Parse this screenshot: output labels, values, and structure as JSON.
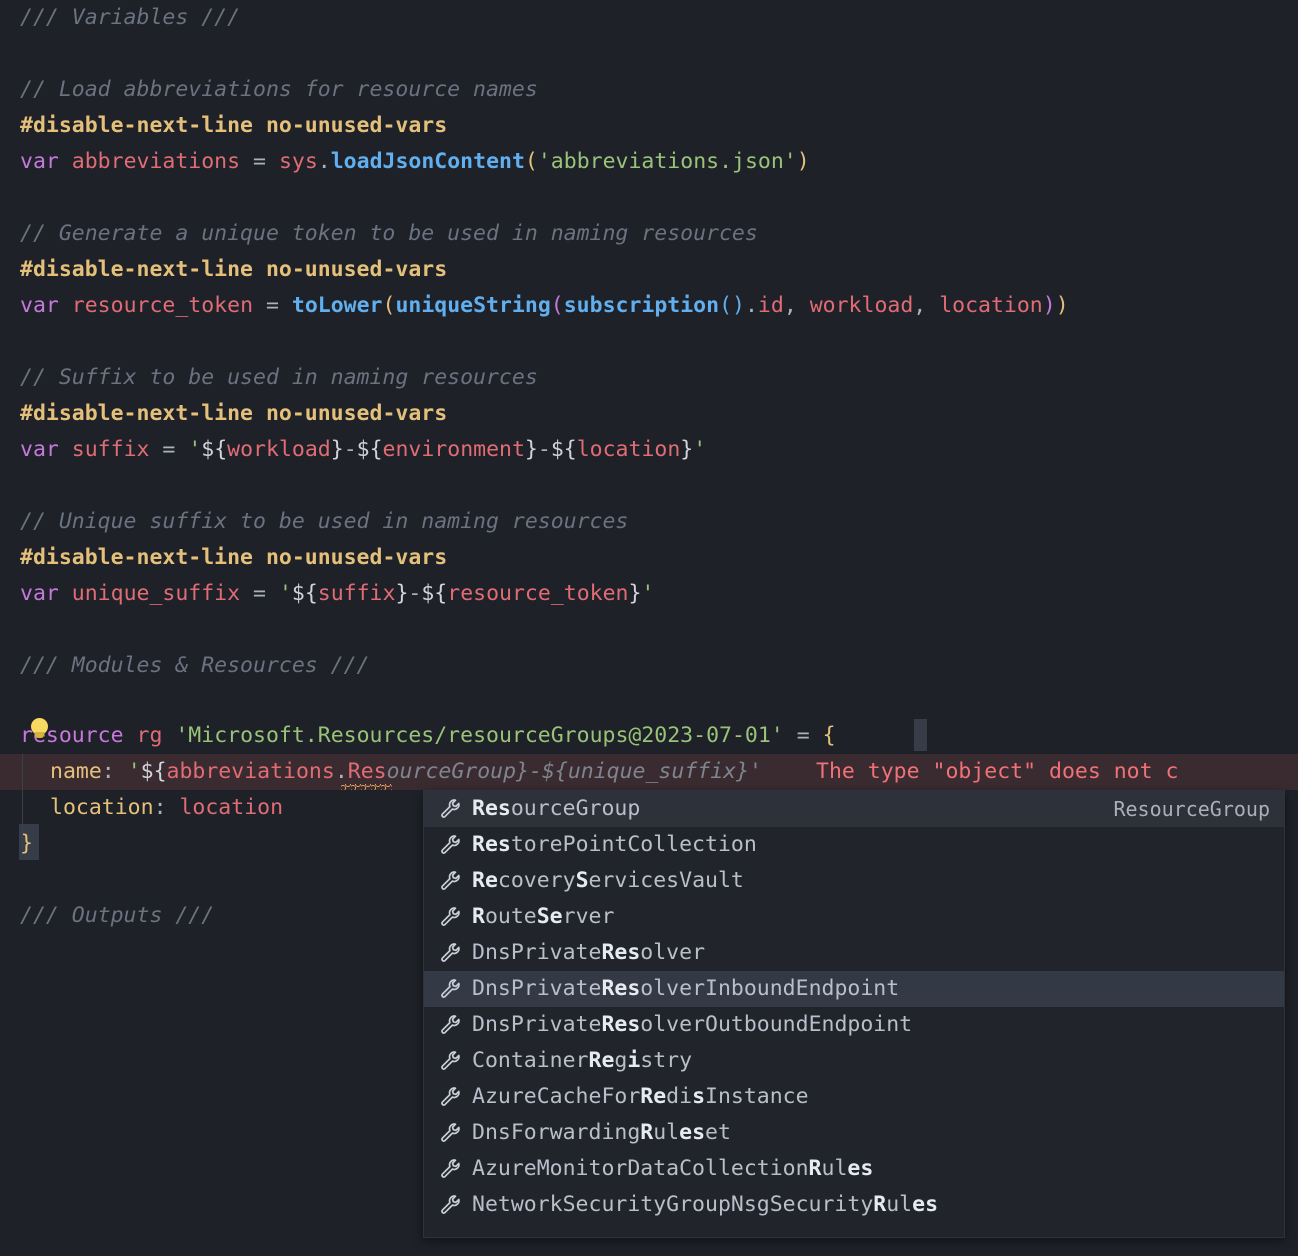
{
  "editor": {
    "language": "bicep",
    "background": "#1e2127",
    "font_size_px": 21.5,
    "line_height_px": 36,
    "colors": {
      "comment": "#6b7280",
      "decorator": "#e5c07b",
      "keyword": "#c678dd",
      "identifier": "#e06c75",
      "function": "#61afef",
      "string": "#98c379",
      "property": "#e5c07b",
      "ghost_text": "#7f848e",
      "error_text": "#f07178",
      "error_line_bg": "#3a2b30",
      "squiggle": "#e5a05b"
    },
    "lines": [
      {
        "n": 1,
        "text": "/// Variables ///"
      },
      {
        "n": 2,
        "text": ""
      },
      {
        "n": 3,
        "text": "// Load abbreviations for resource names"
      },
      {
        "n": 4,
        "text": "#disable-next-line no-unused-vars"
      },
      {
        "n": 5,
        "text": "var abbreviations = sys.loadJsonContent('abbreviations.json')"
      },
      {
        "n": 6,
        "text": ""
      },
      {
        "n": 7,
        "text": "// Generate a unique token to be used in naming resources"
      },
      {
        "n": 8,
        "text": "#disable-next-line no-unused-vars"
      },
      {
        "n": 9,
        "text": "var resource_token = toLower(uniqueString(subscription().id, workload, location))"
      },
      {
        "n": 10,
        "text": ""
      },
      {
        "n": 11,
        "text": "// Suffix to be used in naming resources"
      },
      {
        "n": 12,
        "text": "#disable-next-line no-unused-vars"
      },
      {
        "n": 13,
        "text": "var suffix = '${workload}-${environment}-${location}'"
      },
      {
        "n": 14,
        "text": ""
      },
      {
        "n": 15,
        "text": "// Unique suffix to be used in naming resources"
      },
      {
        "n": 16,
        "text": "#disable-next-line no-unused-vars"
      },
      {
        "n": 17,
        "text": "var unique_suffix = '${suffix}-${resource_token}'"
      },
      {
        "n": 18,
        "text": ""
      },
      {
        "n": 19,
        "text": "/// Modules & Resources ///"
      },
      {
        "n": 20,
        "text": ""
      },
      {
        "n": 21,
        "text": "resource rg 'Microsoft.Resources/resourceGroups@2023-07-01' = {"
      },
      {
        "n": 22,
        "text": "  name: '${abbreviations.ResourceGroup}-${unique_suffix}'"
      },
      {
        "n": 23,
        "text": "  location: location"
      },
      {
        "n": 24,
        "text": "}"
      },
      {
        "n": 25,
        "text": ""
      },
      {
        "n": 26,
        "text": "/// Outputs ///"
      }
    ],
    "tokens": {
      "header_variables": "/// Variables ///",
      "header_modules": "/// Modules & Resources ///",
      "header_outputs": "/// Outputs ///",
      "comment_load": "// Load abbreviations for resource names",
      "comment_token": "// Generate a unique token to be used in naming resources",
      "comment_suffix": "// Suffix to be used in naming resources",
      "comment_unique": "// Unique suffix to be used in naming resources",
      "disable_directive": "#disable-next-line",
      "disable_rule": "no-unused-vars",
      "kw_var": "var",
      "kw_resource": "resource",
      "name_abbreviations": "abbreviations",
      "name_resource_token": "resource_token",
      "name_suffix": "suffix",
      "name_unique_suffix": "unique_suffix",
      "sys_ns": "sys",
      "fn_loadJsonContent": "loadJsonContent",
      "str_abbreviations_json": "'abbreviations.json'",
      "fn_toLower": "toLower",
      "fn_uniqueString": "uniqueString",
      "fn_subscription": "subscription",
      "prop_id": "id",
      "arg_workload": "workload",
      "arg_location": "location",
      "interp_workload": "workload",
      "interp_environment": "environment",
      "interp_location": "location",
      "interp_suffix": "suffix",
      "interp_resource_token": "resource_token",
      "res_symbol": "rg",
      "res_type": "'Microsoft.Resources/resourceGroups@2023-07-01'",
      "prop_name": "name",
      "prop_location": "location",
      "val_location": "location",
      "name_typed": "'${abbreviations.Res",
      "name_ghost": "ourceGroup}-${unique_suffix}'",
      "close_brace": "}",
      "open_brace": "{",
      "equals": "=",
      "colon": ":"
    },
    "diagnostic": {
      "message": "The type \"object\" does not c",
      "severity": "error",
      "line": 22
    },
    "code_action": {
      "icon": "lightbulb-icon",
      "line": 21
    }
  },
  "suggest": {
    "icon_name": "wrench-icon",
    "items": [
      {
        "prefix": "Res",
        "bold": [
          [
            0,
            3
          ]
        ],
        "label": "ResourceGroup",
        "detail": "ResourceGroup",
        "state": "selected"
      },
      {
        "label": "RestorePointCollection",
        "bold": [
          [
            0,
            3
          ]
        ],
        "detail": "",
        "state": "normal"
      },
      {
        "label": "RecoveryServicesVault",
        "bold": [
          [
            0,
            2
          ],
          [
            8,
            9
          ]
        ],
        "detail": "",
        "state": "normal"
      },
      {
        "label": "RouteServer",
        "bold": [
          [
            0,
            1
          ],
          [
            5,
            7
          ]
        ],
        "detail": "",
        "state": "normal"
      },
      {
        "label": "DnsPrivateResolver",
        "bold": [
          [
            10,
            13
          ]
        ],
        "detail": "",
        "state": "normal"
      },
      {
        "label": "DnsPrivateResolverInboundEndpoint",
        "bold": [
          [
            10,
            13
          ]
        ],
        "detail": "",
        "state": "focused"
      },
      {
        "label": "DnsPrivateResolverOutboundEndpoint",
        "bold": [
          [
            10,
            13
          ]
        ],
        "detail": "",
        "state": "normal"
      },
      {
        "label": "ContainerRegistry",
        "bold": [
          [
            9,
            11
          ],
          [
            12,
            13
          ]
        ],
        "detail": "",
        "state": "normal"
      },
      {
        "label": "AzureCacheForRedisInstance",
        "bold": [
          [
            13,
            15
          ],
          [
            17,
            18
          ]
        ],
        "detail": "",
        "state": "normal"
      },
      {
        "label": "DnsForwardingRuleset",
        "bold": [
          [
            13,
            14
          ],
          [
            16,
            18
          ]
        ],
        "detail": "",
        "state": "normal"
      },
      {
        "label": "AzureMonitorDataCollectionRules",
        "bold": [
          [
            26,
            27
          ],
          [
            29,
            31
          ]
        ],
        "detail": "",
        "state": "normal"
      },
      {
        "label": "NetworkSecurityGroupNsgSecurityRules",
        "bold": [
          [
            31,
            32
          ],
          [
            34,
            36
          ]
        ],
        "detail": "",
        "state": "normal"
      }
    ]
  }
}
